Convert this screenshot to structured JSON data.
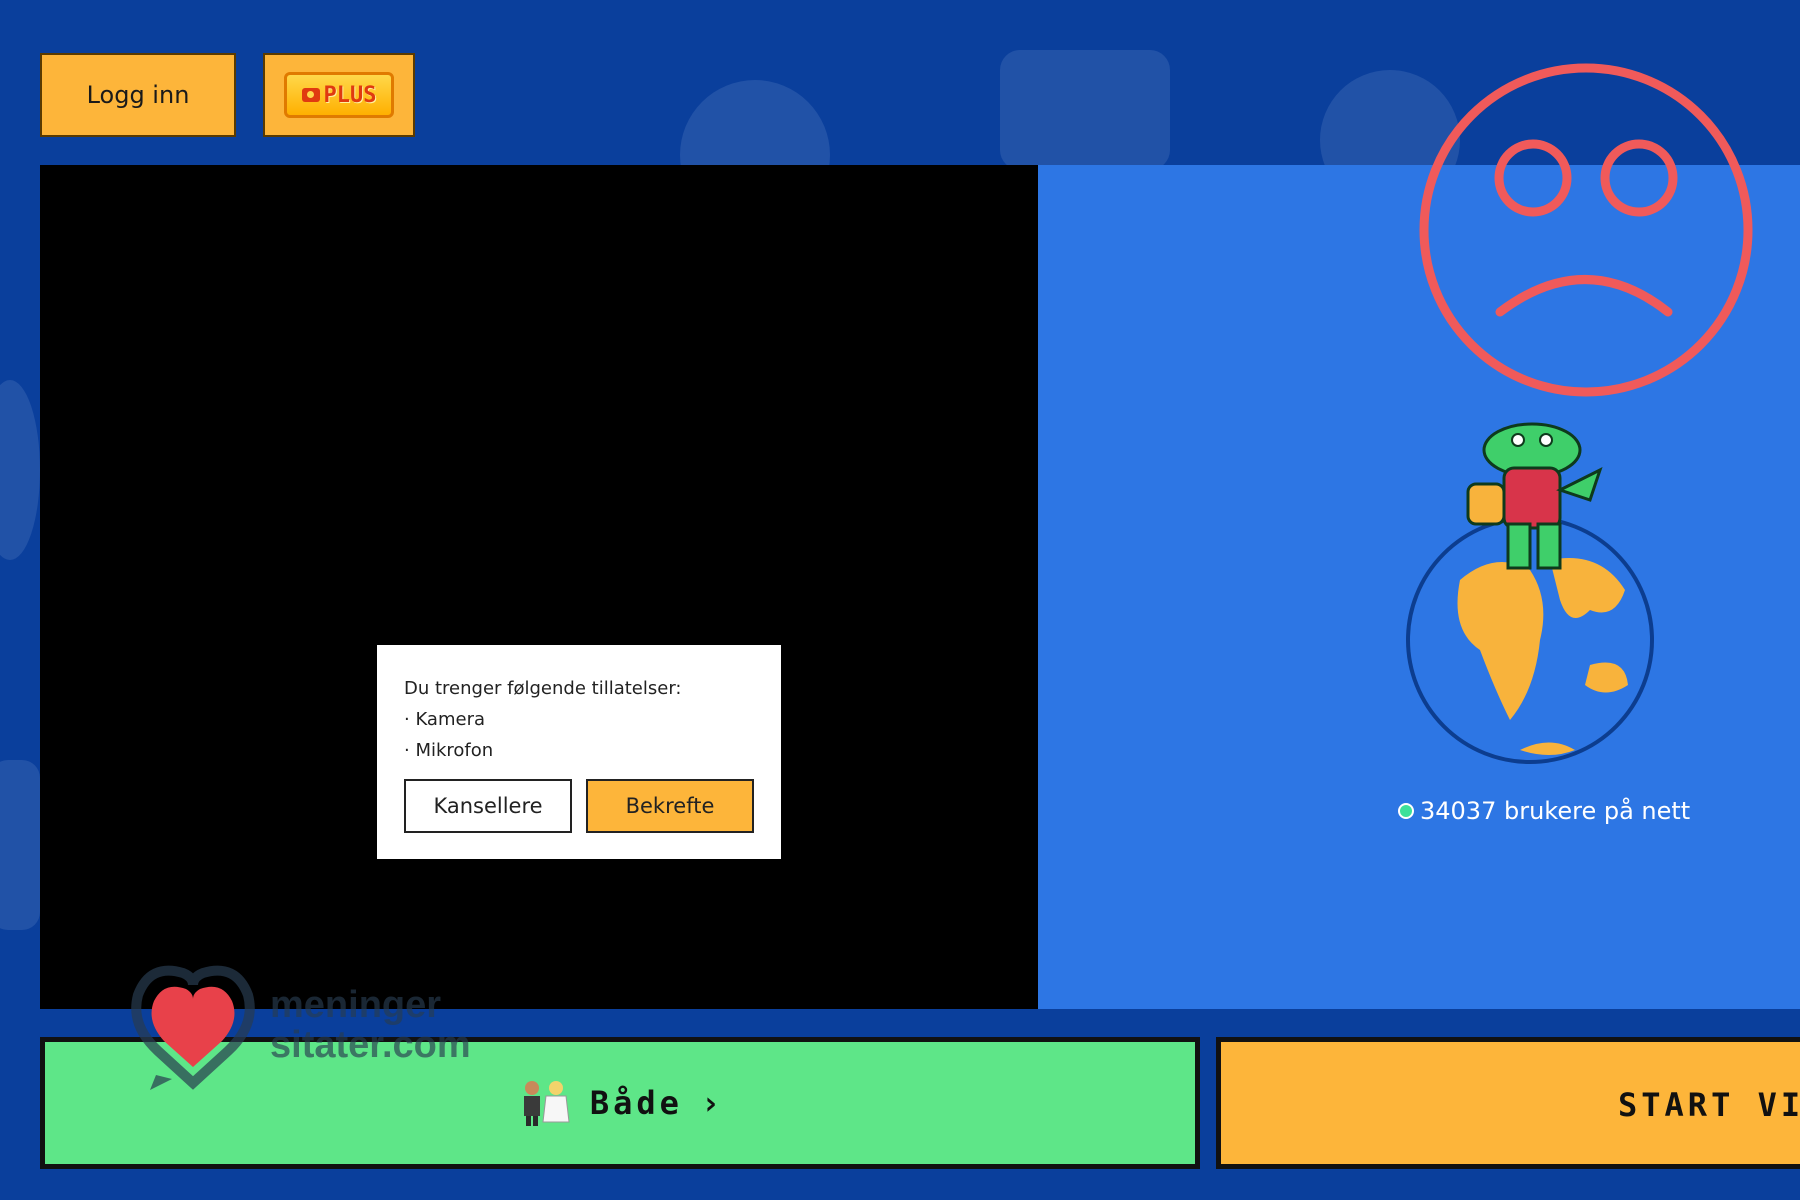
{
  "header": {
    "login_label": "Logg inn",
    "plus_label": "PLUS"
  },
  "dialog": {
    "title": "Du trenger følgende tillatelser:",
    "permissions": [
      "· Kamera",
      "· Mikrofon"
    ],
    "cancel_label": "Kansellere",
    "confirm_label": "Bekrefte"
  },
  "status": {
    "online_text": "34037 brukere på nett"
  },
  "bottom": {
    "gender_label": "Både",
    "gender_chevron": "›",
    "start_label": "START VIDEOCHAT"
  },
  "watermark": {
    "line1": "meninger",
    "line2": "sitater.com"
  },
  "colors": {
    "page_bg": "#0a3f9c",
    "panel_blue": "#2d76e4",
    "accent_yellow": "#fdb53a",
    "green": "#5ee688",
    "sad_face": "#f05a5a"
  }
}
